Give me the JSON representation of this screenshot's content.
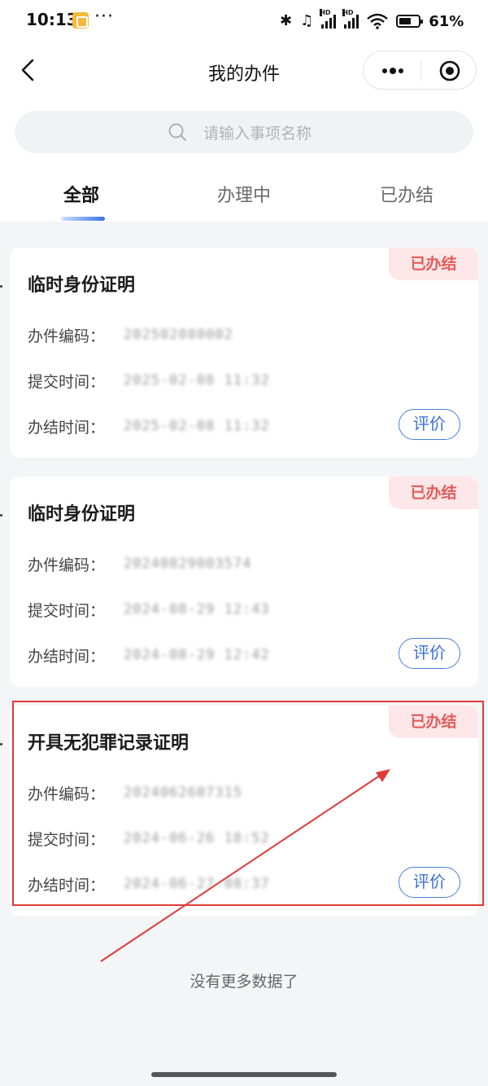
{
  "status_bar": {
    "time": "10:13",
    "dots": "···",
    "bluetooth": "✱",
    "headset": "♫",
    "hd1": "HD",
    "hd2": "HD",
    "battery_level": 0.61,
    "battery_text": "61%"
  },
  "nav": {
    "title": "我的办件",
    "back_icon": "chevron-left-icon",
    "more_icon": "more-dots-icon",
    "close_icon": "target-icon"
  },
  "search": {
    "placeholder": "请输入事项名称",
    "icon": "search-icon"
  },
  "tabs": [
    {
      "label": "全部",
      "active": true
    },
    {
      "label": "办理中",
      "active": false
    },
    {
      "label": "已办结",
      "active": false
    }
  ],
  "cards": [
    {
      "status": "已办结",
      "title": "临时身份证明",
      "rows": [
        {
          "label": "办件编码：",
          "value": "202502080002"
        },
        {
          "label": "提交时间：",
          "value": "2025-02-08 11:32"
        },
        {
          "label": "办结时间：",
          "value": "2025-02-08 11:32"
        }
      ],
      "action": "评价"
    },
    {
      "status": "已办结",
      "title": "临时身份证明",
      "rows": [
        {
          "label": "办件编码：",
          "value": "20240829003574"
        },
        {
          "label": "提交时间：",
          "value": "2024-08-29 12:43"
        },
        {
          "label": "办结时间：",
          "value": "2024-08-29 12:42"
        }
      ],
      "action": "评价"
    },
    {
      "status": "已办结",
      "title": "开具无犯罪记录证明",
      "rows": [
        {
          "label": "办件编码：",
          "value": "2024062607315"
        },
        {
          "label": "提交时间：",
          "value": "2024-06-26 18:52"
        },
        {
          "label": "办结时间：",
          "value": "2024-06-27 08:37"
        }
      ],
      "action": "评价"
    }
  ],
  "footer": {
    "no_more": "没有更多数据了"
  },
  "colors": {
    "accent_blue": "#3a6fd4",
    "status_red": "#e45a5a",
    "annotation_red": "#e03a3a"
  }
}
